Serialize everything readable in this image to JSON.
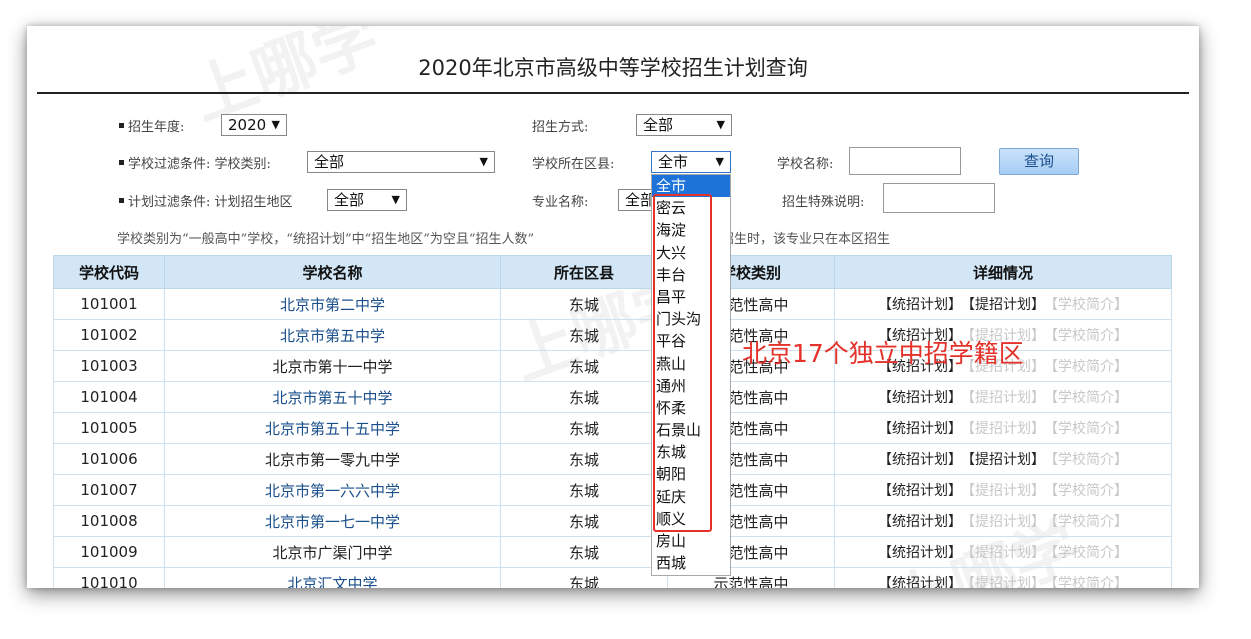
{
  "page_title": "2020年北京市高级中等学校招生计划查询",
  "watermark": "上哪学",
  "filters": {
    "year_label": "招生年度:",
    "year_value": "2020",
    "method_label": "招生方式:",
    "method_value": "全部",
    "school_filter_label": "学校过滤条件: 学校类别:",
    "school_type_value": "全部",
    "district_label": "学校所在区县:",
    "district_value": "全市",
    "school_name_label": "学校名称:",
    "query_button": "查询",
    "plan_filter_label": "计划过滤条件: 计划招生地区",
    "plan_region_value": "全部",
    "major_label": "专业名称:",
    "major_value": "全部",
    "special_label": "招生特殊说明:"
  },
  "note": "学校类别为“一般高中”学校，“统招计划”中“招生地区”为空且“招生人数”",
  "note_tail": "招生时，该专业只在本区招生",
  "table": {
    "headers": [
      "学校代码",
      "学校名称",
      "所在区县",
      "学校类别",
      "详细情况"
    ],
    "rows": [
      {
        "code": "101001",
        "name": "北京市第二中学",
        "district": "东城",
        "type": "示范性高中",
        "plan_a": "【统招计划】",
        "plan_b": "【提招计划】",
        "intro": "【学校简介】",
        "b_on": true,
        "link": true
      },
      {
        "code": "101002",
        "name": "北京市第五中学",
        "district": "东城",
        "type": "示范性高中",
        "plan_a": "【统招计划】",
        "plan_b": "【提招计划】",
        "intro": "【学校简介】",
        "b_on": false,
        "link": true
      },
      {
        "code": "101003",
        "name": "北京市第十一中学",
        "district": "东城",
        "type": "示范性高中",
        "plan_a": "【统招计划】",
        "plan_b": "【提招计划】",
        "intro": "【学校简介】",
        "b_on": false,
        "link": false
      },
      {
        "code": "101004",
        "name": "北京市第五十中学",
        "district": "东城",
        "type": "示范性高中",
        "plan_a": "【统招计划】",
        "plan_b": "【提招计划】",
        "intro": "【学校简介】",
        "b_on": false,
        "link": true
      },
      {
        "code": "101005",
        "name": "北京市第五十五中学",
        "district": "东城",
        "type": "示范性高中",
        "plan_a": "【统招计划】",
        "plan_b": "【提招计划】",
        "intro": "【学校简介】",
        "b_on": false,
        "link": true
      },
      {
        "code": "101006",
        "name": "北京市第一零九中学",
        "district": "东城",
        "type": "示范性高中",
        "plan_a": "【统招计划】",
        "plan_b": "【提招计划】",
        "intro": "【学校简介】",
        "b_on": true,
        "link": false
      },
      {
        "code": "101007",
        "name": "北京市第一六六中学",
        "district": "东城",
        "type": "示范性高中",
        "plan_a": "【统招计划】",
        "plan_b": "【提招计划】",
        "intro": "【学校简介】",
        "b_on": false,
        "link": true
      },
      {
        "code": "101008",
        "name": "北京市第一七一中学",
        "district": "东城",
        "type": "示范性高中",
        "plan_a": "【统招计划】",
        "plan_b": "【提招计划】",
        "intro": "【学校简介】",
        "b_on": false,
        "link": true
      },
      {
        "code": "101009",
        "name": "北京市广渠门中学",
        "district": "东城",
        "type": "示范性高中",
        "plan_a": "【统招计划】",
        "plan_b": "【提招计划】",
        "intro": "【学校简介】",
        "b_on": false,
        "link": false
      },
      {
        "code": "101010",
        "name": "北京汇文中学",
        "district": "东城",
        "type": "示范性高中",
        "plan_a": "【统招计划】",
        "plan_b": "【提招计划】",
        "intro": "【学校简介】",
        "b_on": false,
        "link": true
      }
    ]
  },
  "district_dropdown": {
    "options": [
      "全市",
      "密云",
      "海淀",
      "大兴",
      "丰台",
      "昌平",
      "门头沟",
      "平谷",
      "燕山",
      "通州",
      "怀柔",
      "石景山",
      "东城",
      "朝阳",
      "延庆",
      "顺义",
      "房山",
      "西城"
    ],
    "selected_index": 0
  },
  "annotation": "北京17个独立中招学籍区",
  "colors": {
    "annotation": "#e4322b",
    "highlight": "#1e73d9",
    "header_bg": "#d2e6f6",
    "link": "#1a4f8b"
  }
}
